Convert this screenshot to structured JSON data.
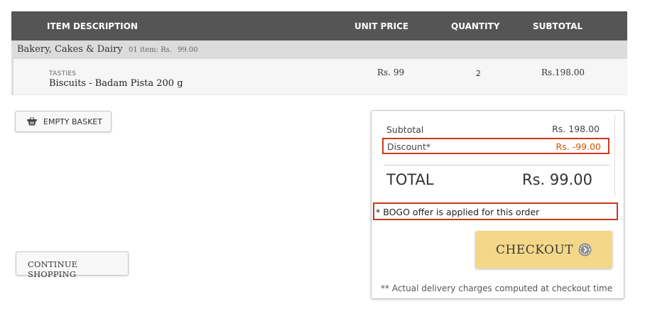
{
  "table": {
    "headers": {
      "description": "ITEM DESCRIPTION",
      "unit_price": "UNIT PRICE",
      "quantity": "QUANTITY",
      "subtotal": "SUBTOTAL"
    },
    "category": {
      "name": "Bakery, Cakes & Dairy",
      "count": "01 item: Rs.",
      "total": "99.00"
    },
    "item": {
      "brand": "TASTIES",
      "name": "Biscuits - Badam Pista 200 g",
      "unit_price": "Rs. 99",
      "quantity": "2",
      "subtotal": "Rs.198.00"
    }
  },
  "buttons": {
    "empty_basket": "EMPTY BASKET",
    "continue_shopping": "CONTINUE SHOPPING",
    "checkout": "CHECKOUT"
  },
  "summary": {
    "subtotal_label": "Subtotal",
    "subtotal_value": "Rs. 198.00",
    "discount_label": "Discount*",
    "discount_value": "Rs. -99.00",
    "total_label": "TOTAL",
    "total_value": "Rs. 99.00",
    "bogo_note": "* BOGO offer is applied for this order",
    "delivery_note": "** Actual delivery charges computed at checkout time"
  },
  "icons": {
    "basket": "basket-icon",
    "checkout_arrow": "arrow-circle-icon"
  },
  "colors": {
    "header_bg": "#555555",
    "category_bg": "#dcdcdc",
    "highlight_border": "#c9391c",
    "discount_text": "#d35400",
    "checkout_bg": "#f5d78a"
  }
}
